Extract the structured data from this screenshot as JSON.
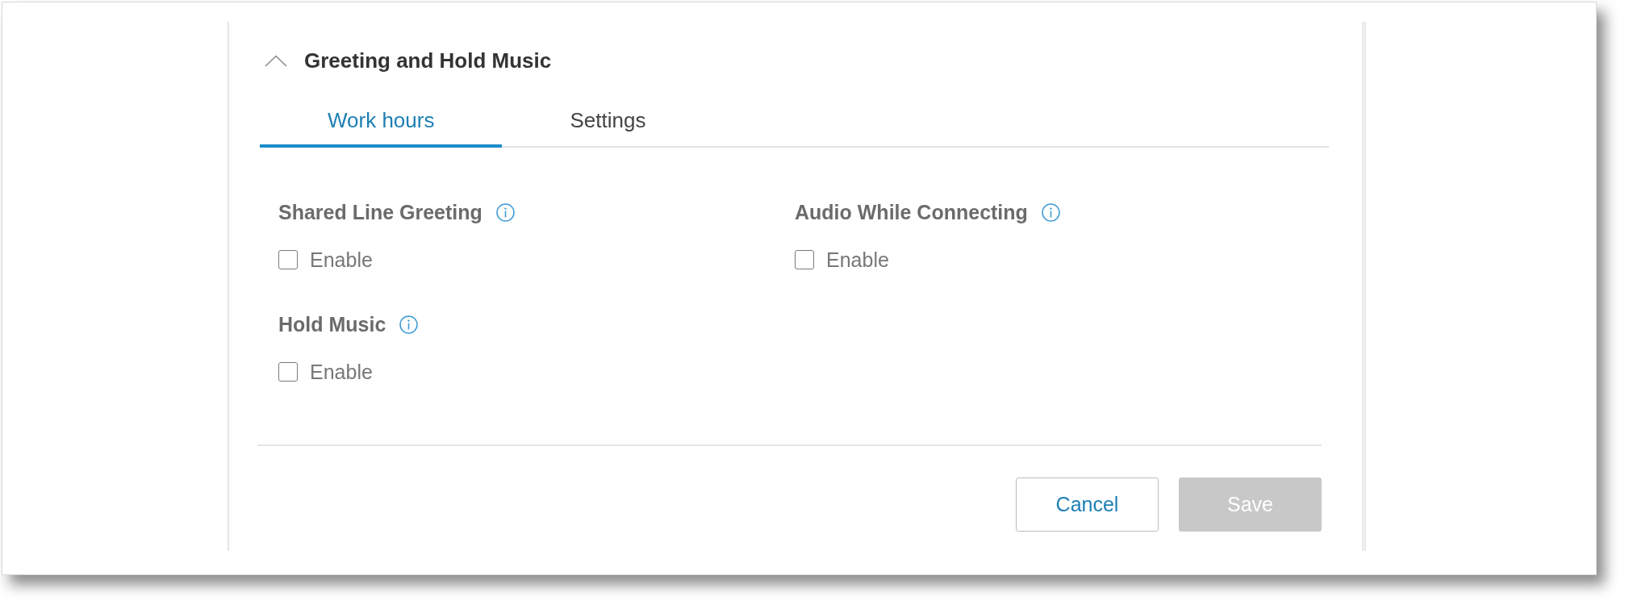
{
  "section": {
    "title": "Greeting and Hold Music",
    "expanded": true
  },
  "tabs": [
    {
      "label": "Work hours",
      "selected": true
    },
    {
      "label": "Settings",
      "selected": false
    }
  ],
  "fields": [
    {
      "label": "Shared Line Greeting",
      "option": "Enable",
      "checked": false
    },
    {
      "label": "Audio While Connecting",
      "option": "Enable",
      "checked": false
    },
    {
      "label": "Hold Music",
      "option": "Enable",
      "checked": false
    }
  ],
  "buttons": [
    {
      "label": "Cancel",
      "kind": "outline",
      "disabled": false
    },
    {
      "label": "Save",
      "kind": "filled",
      "disabled": true
    }
  ]
}
